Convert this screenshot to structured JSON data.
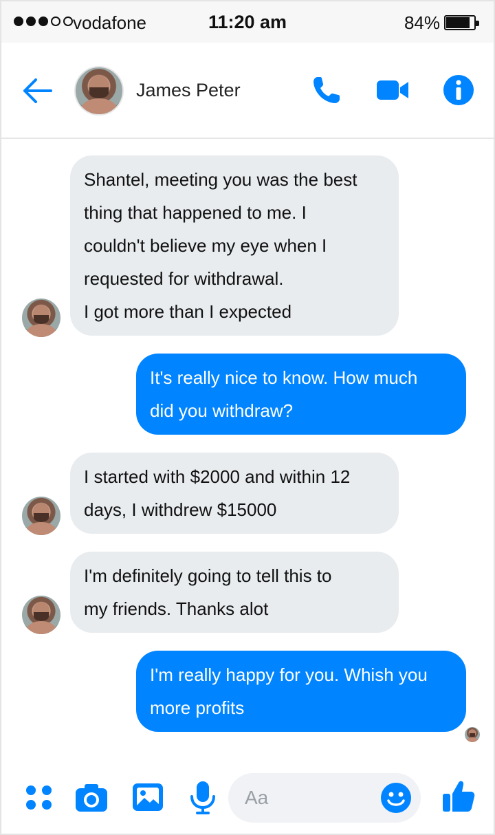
{
  "status_bar": {
    "carrier": "vodafone",
    "signal_bars_filled": 3,
    "signal_bars_total": 5,
    "time": "11:20 am",
    "battery": "84%",
    "battery_level": 0.84
  },
  "header": {
    "contact_name": "James Peter",
    "icons": [
      "back-arrow-icon",
      "phone-icon",
      "video-camera-icon",
      "info-icon"
    ]
  },
  "messages": [
    {
      "side": "received",
      "lines": [
        "Shantel, meeting you was the best",
        "thing that happened to me. I",
        "couldn't believe my eye when I",
        "requested for withdrawal.",
        "I got more than I expected"
      ]
    },
    {
      "side": "sent",
      "lines": [
        "It's really nice to know. How much",
        "did you withdraw?"
      ]
    },
    {
      "side": "received",
      "lines": [
        "I started with $2000 and within 12",
        "days, I withdrew $15000"
      ]
    },
    {
      "side": "received",
      "lines": [
        "I'm definitely going to tell this to",
        "my friends. Thanks alot"
      ]
    },
    {
      "side": "sent",
      "lines": [
        "I'm really happy for you. Whish you",
        "more profits"
      ]
    }
  ],
  "composer": {
    "placeholder": "Aa",
    "icons": [
      "apps-grid-icon",
      "camera-icon",
      "gallery-icon",
      "microphone-icon",
      "emoji-icon",
      "thumbs-up-icon"
    ]
  },
  "colors": {
    "accent": "#0084ff",
    "received_bubble": "#e8ecef",
    "sent_bubble": "#0084ff",
    "status_bar_bg": "#f7f7f7"
  }
}
